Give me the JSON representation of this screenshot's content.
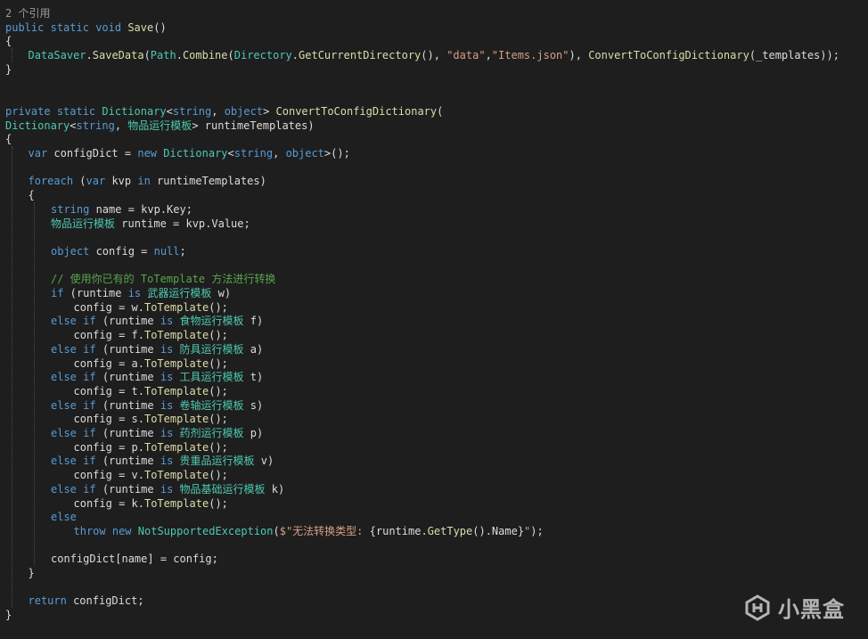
{
  "editor": {
    "colors": {
      "background": "#1e1e1e",
      "keyword": "#569cd6",
      "type": "#4ec9b0",
      "method": "#dcdcaa",
      "string": "#d69d85",
      "comment": "#57a64a",
      "codelens": "#9a9a9a",
      "text": "#dcdcdc"
    },
    "lines": [
      {
        "indent": 0,
        "tokens": [
          {
            "t": "2 个引用",
            "c": "lens"
          }
        ]
      },
      {
        "indent": 0,
        "tokens": [
          {
            "t": "public",
            "c": "kw"
          },
          {
            "t": " "
          },
          {
            "t": "static",
            "c": "kw"
          },
          {
            "t": " "
          },
          {
            "t": "void",
            "c": "kw"
          },
          {
            "t": " "
          },
          {
            "t": "Save",
            "c": "mth"
          },
          {
            "t": "()"
          }
        ]
      },
      {
        "indent": 0,
        "tokens": [
          {
            "t": "{"
          }
        ]
      },
      {
        "indent": 1,
        "tokens": [
          {
            "t": "DataSaver",
            "c": "cls"
          },
          {
            "t": "."
          },
          {
            "t": "SaveData",
            "c": "mth"
          },
          {
            "t": "("
          },
          {
            "t": "Path",
            "c": "cls"
          },
          {
            "t": "."
          },
          {
            "t": "Combine",
            "c": "mth"
          },
          {
            "t": "("
          },
          {
            "t": "Directory",
            "c": "cls"
          },
          {
            "t": "."
          },
          {
            "t": "GetCurrentDirectory",
            "c": "mth"
          },
          {
            "t": "(), "
          },
          {
            "t": "\"data\"",
            "c": "str"
          },
          {
            "t": ","
          },
          {
            "t": "\"Items.json\"",
            "c": "str"
          },
          {
            "t": "), "
          },
          {
            "t": "ConvertToConfigDictionary",
            "c": "mth"
          },
          {
            "t": "(_templates));"
          }
        ]
      },
      {
        "indent": 0,
        "tokens": [
          {
            "t": "}"
          }
        ]
      },
      {
        "indent": 0,
        "tokens": []
      },
      {
        "indent": 0,
        "tokens": []
      },
      {
        "indent": 0,
        "tokens": [
          {
            "t": "private",
            "c": "kw"
          },
          {
            "t": " "
          },
          {
            "t": "static",
            "c": "kw"
          },
          {
            "t": " "
          },
          {
            "t": "Dictionary",
            "c": "cls"
          },
          {
            "t": "<"
          },
          {
            "t": "string",
            "c": "kw"
          },
          {
            "t": ", "
          },
          {
            "t": "object",
            "c": "kw"
          },
          {
            "t": "> "
          },
          {
            "t": "ConvertToConfigDictionary",
            "c": "mth"
          },
          {
            "t": "("
          }
        ]
      },
      {
        "indent": 0,
        "tokens": [
          {
            "t": "Dictionary",
            "c": "cls"
          },
          {
            "t": "<"
          },
          {
            "t": "string",
            "c": "kw"
          },
          {
            "t": ", "
          },
          {
            "t": "物品运行模板",
            "c": "cls"
          },
          {
            "t": "> runtimeTemplates)"
          }
        ]
      },
      {
        "indent": 0,
        "tokens": [
          {
            "t": "{"
          }
        ]
      },
      {
        "indent": 1,
        "tokens": [
          {
            "t": "var",
            "c": "kw"
          },
          {
            "t": " configDict = "
          },
          {
            "t": "new",
            "c": "kw"
          },
          {
            "t": " "
          },
          {
            "t": "Dictionary",
            "c": "cls"
          },
          {
            "t": "<"
          },
          {
            "t": "string",
            "c": "kw"
          },
          {
            "t": ", "
          },
          {
            "t": "object",
            "c": "kw"
          },
          {
            "t": ">();"
          }
        ]
      },
      {
        "indent": 0,
        "tokens": []
      },
      {
        "indent": 1,
        "tokens": [
          {
            "t": "foreach",
            "c": "kw"
          },
          {
            "t": " ("
          },
          {
            "t": "var",
            "c": "kw"
          },
          {
            "t": " kvp "
          },
          {
            "t": "in",
            "c": "kw"
          },
          {
            "t": " runtimeTemplates)"
          }
        ]
      },
      {
        "indent": 1,
        "tokens": [
          {
            "t": "{"
          }
        ]
      },
      {
        "indent": 2,
        "tokens": [
          {
            "t": "string",
            "c": "kw"
          },
          {
            "t": " name = kvp.Key;"
          }
        ]
      },
      {
        "indent": 2,
        "tokens": [
          {
            "t": "物品运行模板",
            "c": "cls"
          },
          {
            "t": " runtime = kvp.Value;"
          }
        ]
      },
      {
        "indent": 0,
        "tokens": []
      },
      {
        "indent": 2,
        "tokens": [
          {
            "t": "object",
            "c": "kw"
          },
          {
            "t": " config = "
          },
          {
            "t": "null",
            "c": "kw"
          },
          {
            "t": ";"
          }
        ]
      },
      {
        "indent": 0,
        "tokens": []
      },
      {
        "indent": 2,
        "tokens": [
          {
            "t": "// 使用你已有的 ToTemplate 方法进行转换",
            "c": "cmt"
          }
        ]
      },
      {
        "indent": 2,
        "tokens": [
          {
            "t": "if",
            "c": "kw"
          },
          {
            "t": " (runtime "
          },
          {
            "t": "is",
            "c": "kw"
          },
          {
            "t": " "
          },
          {
            "t": "武器运行模板",
            "c": "cls"
          },
          {
            "t": " w)"
          }
        ]
      },
      {
        "indent": 3,
        "tokens": [
          {
            "t": "config = w."
          },
          {
            "t": "ToTemplate",
            "c": "mth"
          },
          {
            "t": "();"
          }
        ]
      },
      {
        "indent": 2,
        "tokens": [
          {
            "t": "else",
            "c": "kw"
          },
          {
            "t": " "
          },
          {
            "t": "if",
            "c": "kw"
          },
          {
            "t": " (runtime "
          },
          {
            "t": "is",
            "c": "kw"
          },
          {
            "t": " "
          },
          {
            "t": "食物运行模板",
            "c": "cls"
          },
          {
            "t": " f)"
          }
        ]
      },
      {
        "indent": 3,
        "tokens": [
          {
            "t": "config = f."
          },
          {
            "t": "ToTemplate",
            "c": "mth"
          },
          {
            "t": "();"
          }
        ]
      },
      {
        "indent": 2,
        "tokens": [
          {
            "t": "else",
            "c": "kw"
          },
          {
            "t": " "
          },
          {
            "t": "if",
            "c": "kw"
          },
          {
            "t": " (runtime "
          },
          {
            "t": "is",
            "c": "kw"
          },
          {
            "t": " "
          },
          {
            "t": "防具运行模板",
            "c": "cls"
          },
          {
            "t": " a)"
          }
        ]
      },
      {
        "indent": 3,
        "tokens": [
          {
            "t": "config = a."
          },
          {
            "t": "ToTemplate",
            "c": "mth"
          },
          {
            "t": "();"
          }
        ]
      },
      {
        "indent": 2,
        "tokens": [
          {
            "t": "else",
            "c": "kw"
          },
          {
            "t": " "
          },
          {
            "t": "if",
            "c": "kw"
          },
          {
            "t": " (runtime "
          },
          {
            "t": "is",
            "c": "kw"
          },
          {
            "t": " "
          },
          {
            "t": "工具运行模板",
            "c": "cls"
          },
          {
            "t": " t)"
          }
        ]
      },
      {
        "indent": 3,
        "tokens": [
          {
            "t": "config = t."
          },
          {
            "t": "ToTemplate",
            "c": "mth"
          },
          {
            "t": "();"
          }
        ]
      },
      {
        "indent": 2,
        "tokens": [
          {
            "t": "else",
            "c": "kw"
          },
          {
            "t": " "
          },
          {
            "t": "if",
            "c": "kw"
          },
          {
            "t": " (runtime "
          },
          {
            "t": "is",
            "c": "kw"
          },
          {
            "t": " "
          },
          {
            "t": "卷轴运行模板",
            "c": "cls"
          },
          {
            "t": " s)"
          }
        ]
      },
      {
        "indent": 3,
        "tokens": [
          {
            "t": "config = s."
          },
          {
            "t": "ToTemplate",
            "c": "mth"
          },
          {
            "t": "();"
          }
        ]
      },
      {
        "indent": 2,
        "tokens": [
          {
            "t": "else",
            "c": "kw"
          },
          {
            "t": " "
          },
          {
            "t": "if",
            "c": "kw"
          },
          {
            "t": " (runtime "
          },
          {
            "t": "is",
            "c": "kw"
          },
          {
            "t": " "
          },
          {
            "t": "药剂运行模板",
            "c": "cls"
          },
          {
            "t": " p)"
          }
        ]
      },
      {
        "indent": 3,
        "tokens": [
          {
            "t": "config = p."
          },
          {
            "t": "ToTemplate",
            "c": "mth"
          },
          {
            "t": "();"
          }
        ]
      },
      {
        "indent": 2,
        "tokens": [
          {
            "t": "else",
            "c": "kw"
          },
          {
            "t": " "
          },
          {
            "t": "if",
            "c": "kw"
          },
          {
            "t": " (runtime "
          },
          {
            "t": "is",
            "c": "kw"
          },
          {
            "t": " "
          },
          {
            "t": "贵重品运行模板",
            "c": "cls"
          },
          {
            "t": " v)"
          }
        ]
      },
      {
        "indent": 3,
        "tokens": [
          {
            "t": "config = v."
          },
          {
            "t": "ToTemplate",
            "c": "mth"
          },
          {
            "t": "();"
          }
        ]
      },
      {
        "indent": 2,
        "tokens": [
          {
            "t": "else",
            "c": "kw"
          },
          {
            "t": " "
          },
          {
            "t": "if",
            "c": "kw"
          },
          {
            "t": " (runtime "
          },
          {
            "t": "is",
            "c": "kw"
          },
          {
            "t": " "
          },
          {
            "t": "物品基础运行模板",
            "c": "cls"
          },
          {
            "t": " k)"
          }
        ]
      },
      {
        "indent": 3,
        "tokens": [
          {
            "t": "config = k."
          },
          {
            "t": "ToTemplate",
            "c": "mth"
          },
          {
            "t": "();"
          }
        ]
      },
      {
        "indent": 2,
        "tokens": [
          {
            "t": "else",
            "c": "kw"
          }
        ]
      },
      {
        "indent": 3,
        "tokens": [
          {
            "t": "throw",
            "c": "kw"
          },
          {
            "t": " "
          },
          {
            "t": "new",
            "c": "kw"
          },
          {
            "t": " "
          },
          {
            "t": "NotSupportedException",
            "c": "cls"
          },
          {
            "t": "("
          },
          {
            "t": "$\"无法转换类型: ",
            "c": "str"
          },
          {
            "t": "{runtime."
          },
          {
            "t": "GetType",
            "c": "mth"
          },
          {
            "t": "().Name}"
          },
          {
            "t": "\"",
            "c": "str"
          },
          {
            "t": ");"
          }
        ]
      },
      {
        "indent": 0,
        "tokens": []
      },
      {
        "indent": 2,
        "tokens": [
          {
            "t": "configDict[name] = config;"
          }
        ]
      },
      {
        "indent": 1,
        "tokens": [
          {
            "t": "}"
          }
        ]
      },
      {
        "indent": 0,
        "tokens": []
      },
      {
        "indent": 1,
        "tokens": [
          {
            "t": "return",
            "c": "kw"
          },
          {
            "t": " configDict;"
          }
        ]
      },
      {
        "indent": 0,
        "tokens": [
          {
            "t": "}"
          }
        ]
      }
    ]
  },
  "watermark": {
    "logo_icon": "xiaoheihe-logo-icon",
    "text": "小黑盒"
  }
}
